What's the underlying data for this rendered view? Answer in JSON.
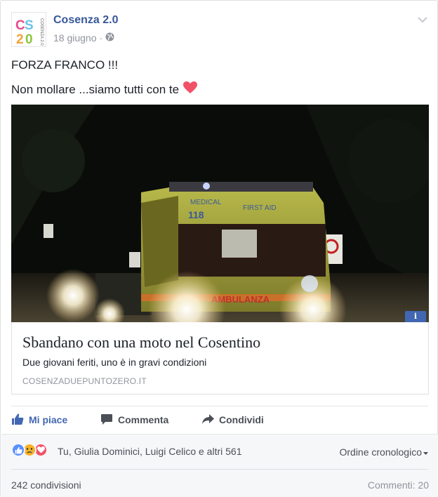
{
  "post": {
    "page_name": "Cosenza 2.0",
    "date": "18 giugno",
    "separator": "·",
    "message_line1": "FORZA FRANCO !!!",
    "message_line2": "Non mollare ...siamo tutti con te",
    "logo_text": "CS20",
    "logo_vertical_text": "COSENZA 2.0"
  },
  "link": {
    "title": "Sbandano con una moto nel Cosentino",
    "description": "Due giovani feriti, uno è in gravi condizioni",
    "domain": "COSENZADUEPUNTOZERO.IT",
    "info_icon": "i",
    "image_texts": {
      "medical": "MEDICAL",
      "number": "118",
      "first_aid": "FIRST AID",
      "ambulanza": "AMBULANZA"
    }
  },
  "actions": {
    "like": "Mi piace",
    "comment": "Commenta",
    "share": "Condividi"
  },
  "footer": {
    "reactions_text": "Tu, Giulia Dominici, Luigi Celico e altri 561",
    "order_label": "Ordine cronologico",
    "shares": "242 condivisioni",
    "comments": "Commenti: 20"
  },
  "colors": {
    "brand": "#365899",
    "like_active": "#4267b2",
    "heart": "#f25268",
    "sad": "#f7b125"
  },
  "icons": [
    "chevron-down-icon",
    "globe-icon",
    "heart-emoji-icon",
    "info-icon",
    "thumbs-up-icon",
    "comment-icon",
    "share-icon",
    "like-reaction-icon",
    "sad-reaction-icon",
    "love-reaction-icon",
    "caret-down-icon"
  ]
}
